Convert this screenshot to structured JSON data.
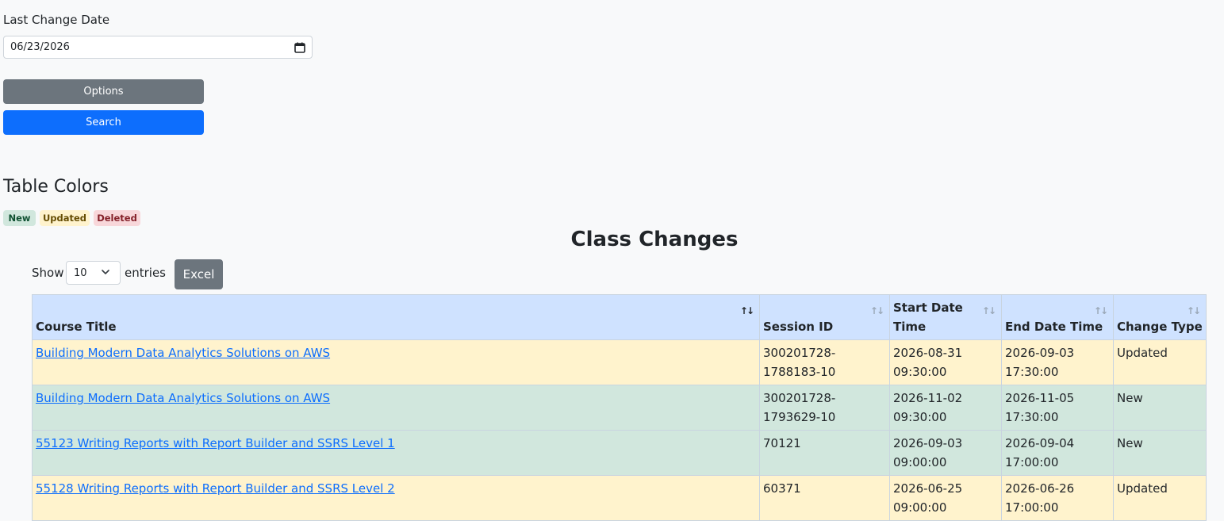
{
  "filter": {
    "last_change_label": "Last Change Date",
    "last_change_value": "06/23/2026"
  },
  "buttons": {
    "options": "Options",
    "search": "Search",
    "excel": "Excel"
  },
  "legend": {
    "title": "Table Colors",
    "new": "New",
    "updated": "Updated",
    "deleted": "Deleted"
  },
  "page_title": "Class Changes",
  "length": {
    "show": "Show",
    "value": "10",
    "entries": "entries"
  },
  "columns": [
    "Course Title",
    "Session ID",
    "Start Date Time",
    "End Date Time",
    "Change Type"
  ],
  "rows": [
    {
      "course": "Building Modern Data Analytics Solutions on AWS",
      "session": "300201728-1788183-10",
      "start": "2026-08-31 09:30:00",
      "end": "2026-09-03 17:30:00",
      "type": "Updated"
    },
    {
      "course": "Building Modern Data Analytics Solutions on AWS",
      "session": "300201728-1793629-10",
      "start": "2026-11-02 09:30:00",
      "end": "2026-11-05 17:30:00",
      "type": "New"
    },
    {
      "course": "55123 Writing Reports with Report Builder and SSRS Level 1",
      "session": "70121",
      "start": "2026-09-03 09:00:00",
      "end": "2026-09-04 17:00:00",
      "type": "New"
    },
    {
      "course": "55128 Writing Reports with Report Builder and SSRS Level 2",
      "session": "60371",
      "start": "2026-06-25 09:00:00",
      "end": "2026-06-26 17:00:00",
      "type": "Updated"
    }
  ],
  "colors": {
    "new_bg": "#d1e7dd",
    "updated_bg": "#fff3cd",
    "deleted_bg": "#f8d7da",
    "header_bg": "#cfe2ff",
    "primary": "#0d6efd",
    "secondary": "#6c757d"
  },
  "icons": {
    "date_picker": "calendar-icon",
    "select": "chevron-down-icon",
    "sort": "sort-arrows-icon"
  }
}
